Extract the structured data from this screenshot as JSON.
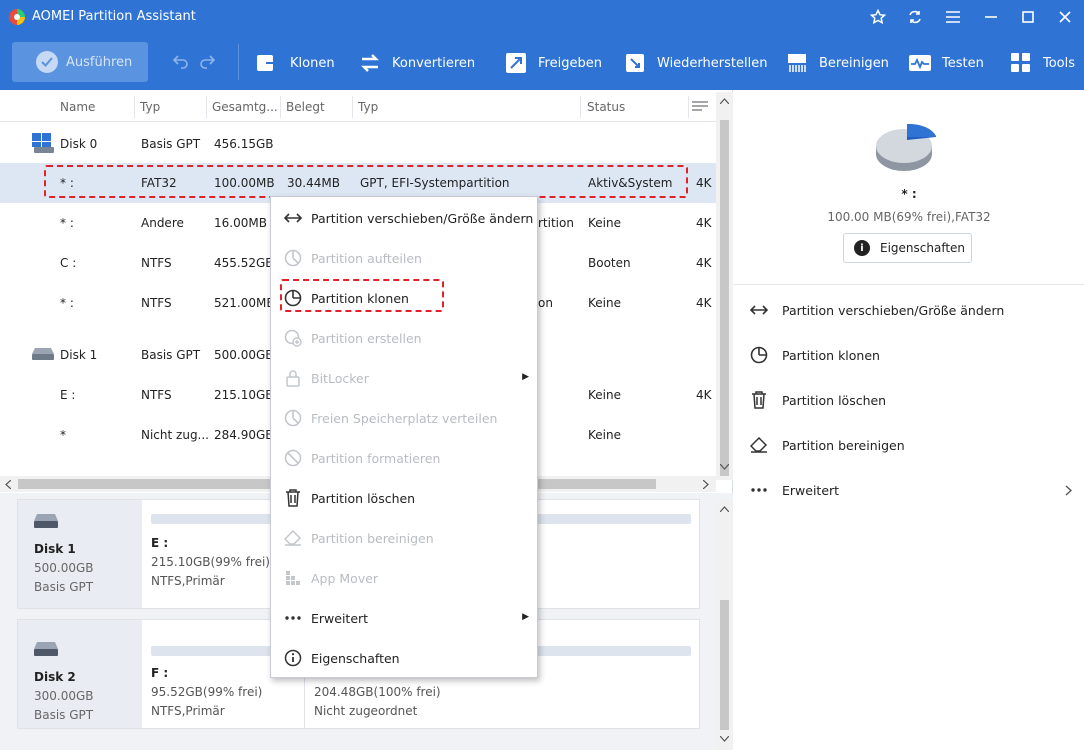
{
  "app": {
    "title": "AOMEI Partition Assistant"
  },
  "toolbar": {
    "execute_label": "Ausführen",
    "tools": [
      "Klonen",
      "Konvertieren",
      "Freigeben",
      "Wiederherstellen",
      "Bereinigen",
      "Testen",
      "Tools"
    ]
  },
  "table": {
    "headers": [
      "Name",
      "Typ",
      "Gesamtg...",
      "Belegt",
      "Typ",
      "Status"
    ],
    "disk0": {
      "name": "Disk 0",
      "type": "Basis GPT",
      "size": "456.15GB"
    },
    "disk1": {
      "name": "Disk 1",
      "type": "Basis GPT",
      "size": "500.00GB"
    },
    "rows": [
      {
        "name": "* :",
        "fs": "FAT32",
        "total": "100.00MB",
        "used": "30.44MB",
        "ptype": "GPT, EFI-Systempartition",
        "status": "Aktiv&System",
        "extra": "4K"
      },
      {
        "name": "* :",
        "fs": "Andere",
        "total": "16.00MB",
        "used": "",
        "ptype": "rtition",
        "status": "Keine",
        "extra": "4K"
      },
      {
        "name": "C :",
        "fs": "NTFS",
        "total": "455.52GB",
        "used": "",
        "ptype": "",
        "status": "Booten",
        "extra": "4K"
      },
      {
        "name": "* :",
        "fs": "NTFS",
        "total": "521.00MB",
        "used": "",
        "ptype": "on",
        "status": "Keine",
        "extra": "4K"
      },
      {
        "name": "E :",
        "fs": "NTFS",
        "total": "215.10GB",
        "used": "",
        "ptype": "",
        "status": "Keine",
        "extra": "4K"
      },
      {
        "name": "*",
        "fs": "Nicht zug...",
        "total": "284.90GB",
        "used": "",
        "ptype": "",
        "status": "Keine",
        "extra": ""
      }
    ]
  },
  "cards": [
    {
      "disk": "Disk 1",
      "size": "500.00GB",
      "type": "Basis GPT",
      "p1_name": "E :",
      "p1_size": "215.10GB(99% frei)",
      "p1_fs": "NTFS,Primär"
    },
    {
      "disk": "Disk 2",
      "size": "300.00GB",
      "type": "Basis GPT",
      "p1_name": "F :",
      "p1_size": "95.52GB(99% frei)",
      "p1_fs": "NTFS,Primär",
      "p2_size": "204.48GB(100% frei)",
      "p2_fs": "Nicht zugeordnet"
    }
  ],
  "right_panel": {
    "partition_name": "* :",
    "partition_desc": "100.00 MB(69% frei),FAT32",
    "properties_label": "Eigenschaften",
    "actions": [
      "Partition verschieben/Größe ändern",
      "Partition klonen",
      "Partition löschen",
      "Partition bereinigen",
      "Erweitert"
    ]
  },
  "context_menu": {
    "items": [
      "Partition verschieben/Größe ändern",
      "Partition aufteilen",
      "Partition klonen",
      "Partition erstellen",
      "BitLocker",
      "Freien Speicherplatz verteilen",
      "Partition formatieren",
      "Partition löschen",
      "Partition bereinigen",
      "App Mover",
      "Erweitert",
      "Eigenschaften"
    ]
  },
  "colors": {
    "accent": "#2f74d5",
    "highlight": "#e2222a",
    "pie_used": "#2f74d5",
    "pie_free": "#c9ced6"
  }
}
